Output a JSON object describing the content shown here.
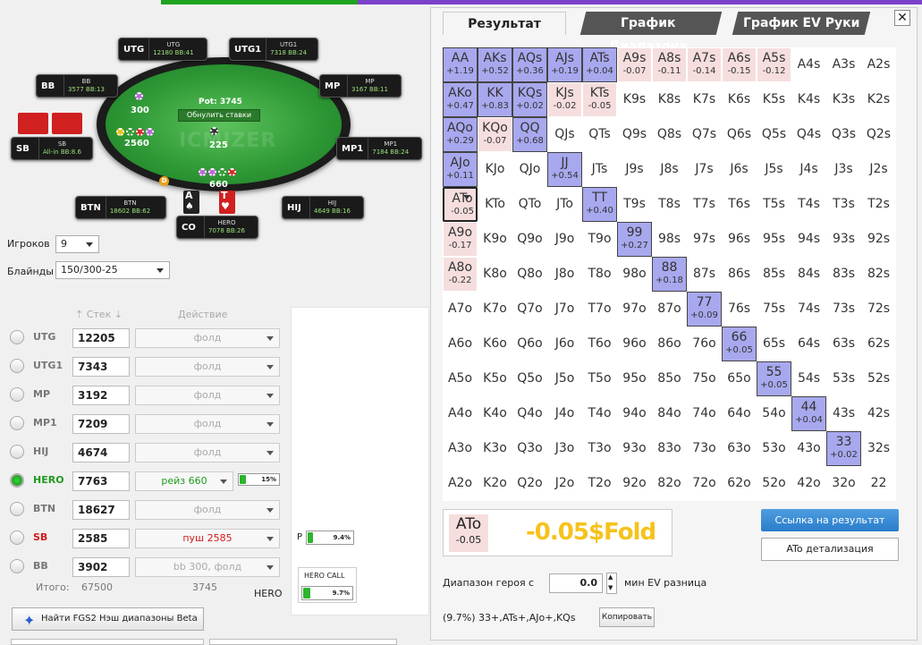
{
  "table": {
    "pot_label": "Pot: 3745",
    "reset_label": "Обнулить ставки",
    "watermark": "ICMIZER",
    "bets": [
      {
        "id": "utg",
        "value": "300"
      },
      {
        "id": "sb",
        "value": "2560"
      },
      {
        "id": "center",
        "value": "225"
      },
      {
        "id": "hero",
        "value": "660"
      }
    ],
    "dealer": "D",
    "hero_cards": [
      {
        "rank": "A",
        "suit": "♠"
      },
      {
        "rank": "T",
        "suit": "♥"
      }
    ],
    "seats": [
      {
        "id": "utg",
        "name": "UTG",
        "label": "UTG",
        "stack": "12180",
        "bb": "41"
      },
      {
        "id": "utg1",
        "name": "UTG1",
        "label": "UTG1",
        "stack": "7318",
        "bb": "24"
      },
      {
        "id": "bb",
        "name": "BB",
        "label": "BB",
        "stack": "3577",
        "bb": "13"
      },
      {
        "id": "mp",
        "name": "MP",
        "label": "MP",
        "stack": "3167",
        "bb": "11"
      },
      {
        "id": "sb",
        "name": "SB",
        "label": "SB",
        "stack": "All-in",
        "bb": "8.6"
      },
      {
        "id": "mp1",
        "name": "MP1",
        "label": "MP1",
        "stack": "7184",
        "bb": "24"
      },
      {
        "id": "btn",
        "name": "BTN",
        "label": "BTN",
        "stack": "18602",
        "bb": "62"
      },
      {
        "id": "hij",
        "name": "HIJ",
        "label": "HIJ",
        "stack": "4649",
        "bb": "16"
      },
      {
        "id": "co",
        "name": "CO",
        "label": "HERO",
        "stack": "7078",
        "bb": "26"
      }
    ]
  },
  "controls": {
    "players_label": "Игроков",
    "players_value": "9",
    "blinds_label": "Блайнды",
    "blinds_value": "150/300-25"
  },
  "players_table": {
    "stack_header": "Стек",
    "action_header": "Действие",
    "rows": [
      {
        "name": "UTG",
        "stack": "12205",
        "action": "фолд",
        "selected": false,
        "color": "#777"
      },
      {
        "name": "UTG1",
        "stack": "7343",
        "action": "фолд",
        "selected": false,
        "color": "#777"
      },
      {
        "name": "MP",
        "stack": "3192",
        "action": "фолд",
        "selected": false,
        "color": "#777"
      },
      {
        "name": "MP1",
        "stack": "7209",
        "action": "фолд",
        "selected": false,
        "color": "#777"
      },
      {
        "name": "HIJ",
        "stack": "4674",
        "action": "фолд",
        "selected": false,
        "color": "#777"
      },
      {
        "name": "HERO",
        "stack": "7763",
        "action": "рейз 660",
        "selected": true,
        "color": "#1e9a1e"
      },
      {
        "name": "BTN",
        "stack": "18627",
        "action": "фолд",
        "selected": false,
        "color": "#777"
      },
      {
        "name": "SB",
        "stack": "2585",
        "action": "пуш 2585",
        "selected": false,
        "color": "#d21a1a"
      },
      {
        "name": "BB",
        "stack": "3902",
        "action": "bb 300, фолд",
        "selected": false,
        "color": "#777"
      }
    ],
    "hero_equity": "15%",
    "hero_equity_value": 0.15,
    "total_label": "Итого:",
    "total_stack": "67500",
    "total_pot": "3745",
    "p_label": "P",
    "p_equity": "9.4%",
    "p_equity_value": 0.094,
    "hero_call_label": "HERO CALL",
    "hero_call_equity": "9.7%",
    "hero_call_value": 0.097,
    "hero_label": "HERO"
  },
  "find_button": "Найти FGS2 Нэш диапазоны Beta",
  "tabs": [
    "Результат",
    "График Диапазона",
    "График EV Руки"
  ],
  "close_label": "✕",
  "matrix": [
    [
      [
        "AA",
        "+1.19",
        "pos"
      ],
      [
        "AKs",
        "+0.52",
        "pos"
      ],
      [
        "AQs",
        "+0.36",
        "pos"
      ],
      [
        "AJs",
        "+0.19",
        "pos"
      ],
      [
        "ATs",
        "+0.04",
        "pos"
      ],
      [
        "A9s",
        "-0.07",
        "neg"
      ],
      [
        "A8s",
        "-0.11",
        "neg"
      ],
      [
        "A7s",
        "-0.14",
        "neg"
      ],
      [
        "A6s",
        "-0.15",
        "neg"
      ],
      [
        "A5s",
        "-0.12",
        "neg"
      ],
      [
        "A4s",
        "",
        ""
      ],
      [
        "A3s",
        "",
        ""
      ],
      [
        "A2s",
        "",
        ""
      ]
    ],
    [
      [
        "AKo",
        "+0.47",
        "pos"
      ],
      [
        "KK",
        "+0.83",
        "pos"
      ],
      [
        "KQs",
        "+0.02",
        "pos"
      ],
      [
        "KJs",
        "-0.02",
        "neg"
      ],
      [
        "KTs",
        "-0.05",
        "neg"
      ],
      [
        "K9s",
        "",
        ""
      ],
      [
        "K8s",
        "",
        ""
      ],
      [
        "K7s",
        "",
        ""
      ],
      [
        "K6s",
        "",
        ""
      ],
      [
        "K5s",
        "",
        ""
      ],
      [
        "K4s",
        "",
        ""
      ],
      [
        "K3s",
        "",
        ""
      ],
      [
        "K2s",
        "",
        ""
      ]
    ],
    [
      [
        "AQo",
        "+0.29",
        "pos"
      ],
      [
        "KQo",
        "-0.07",
        "neg"
      ],
      [
        "QQ",
        "+0.68",
        "pos"
      ],
      [
        "QJs",
        "",
        ""
      ],
      [
        "QTs",
        "",
        ""
      ],
      [
        "Q9s",
        "",
        ""
      ],
      [
        "Q8s",
        "",
        ""
      ],
      [
        "Q7s",
        "",
        ""
      ],
      [
        "Q6s",
        "",
        ""
      ],
      [
        "Q5s",
        "",
        ""
      ],
      [
        "Q4s",
        "",
        ""
      ],
      [
        "Q3s",
        "",
        ""
      ],
      [
        "Q2s",
        "",
        ""
      ]
    ],
    [
      [
        "AJo",
        "+0.11",
        "pos"
      ],
      [
        "KJo",
        "",
        ""
      ],
      [
        "QJo",
        "",
        ""
      ],
      [
        "JJ",
        "+0.54",
        "pos"
      ],
      [
        "JTs",
        "",
        ""
      ],
      [
        "J9s",
        "",
        ""
      ],
      [
        "J8s",
        "",
        ""
      ],
      [
        "J7s",
        "",
        ""
      ],
      [
        "J6s",
        "",
        ""
      ],
      [
        "J5s",
        "",
        ""
      ],
      [
        "J4s",
        "",
        ""
      ],
      [
        "J3s",
        "",
        ""
      ],
      [
        "J2s",
        "",
        ""
      ]
    ],
    [
      [
        "ATo",
        "-0.05",
        "sel"
      ],
      [
        "KTo",
        "",
        ""
      ],
      [
        "QTo",
        "",
        ""
      ],
      [
        "JTo",
        "",
        ""
      ],
      [
        "TT",
        "+0.40",
        "pos"
      ],
      [
        "T9s",
        "",
        ""
      ],
      [
        "T8s",
        "",
        ""
      ],
      [
        "T7s",
        "",
        ""
      ],
      [
        "T6s",
        "",
        ""
      ],
      [
        "T5s",
        "",
        ""
      ],
      [
        "T4s",
        "",
        ""
      ],
      [
        "T3s",
        "",
        ""
      ],
      [
        "T2s",
        "",
        ""
      ]
    ],
    [
      [
        "A9o",
        "-0.17",
        "neg"
      ],
      [
        "K9o",
        "",
        ""
      ],
      [
        "Q9o",
        "",
        ""
      ],
      [
        "J9o",
        "",
        ""
      ],
      [
        "T9o",
        "",
        ""
      ],
      [
        "99",
        "+0.27",
        "pos"
      ],
      [
        "98s",
        "",
        ""
      ],
      [
        "97s",
        "",
        ""
      ],
      [
        "96s",
        "",
        ""
      ],
      [
        "95s",
        "",
        ""
      ],
      [
        "94s",
        "",
        ""
      ],
      [
        "93s",
        "",
        ""
      ],
      [
        "92s",
        "",
        ""
      ]
    ],
    [
      [
        "A8o",
        "-0.22",
        "neg"
      ],
      [
        "K8o",
        "",
        ""
      ],
      [
        "Q8o",
        "",
        ""
      ],
      [
        "J8o",
        "",
        ""
      ],
      [
        "T8o",
        "",
        ""
      ],
      [
        "98o",
        "",
        ""
      ],
      [
        "88",
        "+0.18",
        "pos"
      ],
      [
        "87s",
        "",
        ""
      ],
      [
        "86s",
        "",
        ""
      ],
      [
        "85s",
        "",
        ""
      ],
      [
        "84s",
        "",
        ""
      ],
      [
        "83s",
        "",
        ""
      ],
      [
        "82s",
        "",
        ""
      ]
    ],
    [
      [
        "A7o",
        "",
        ""
      ],
      [
        "K7o",
        "",
        ""
      ],
      [
        "Q7o",
        "",
        ""
      ],
      [
        "J7o",
        "",
        ""
      ],
      [
        "T7o",
        "",
        ""
      ],
      [
        "97o",
        "",
        ""
      ],
      [
        "87o",
        "",
        ""
      ],
      [
        "77",
        "+0.09",
        "pos"
      ],
      [
        "76s",
        "",
        ""
      ],
      [
        "75s",
        "",
        ""
      ],
      [
        "74s",
        "",
        ""
      ],
      [
        "73s",
        "",
        ""
      ],
      [
        "72s",
        "",
        ""
      ]
    ],
    [
      [
        "A6o",
        "",
        ""
      ],
      [
        "K6o",
        "",
        ""
      ],
      [
        "Q6o",
        "",
        ""
      ],
      [
        "J6o",
        "",
        ""
      ],
      [
        "T6o",
        "",
        ""
      ],
      [
        "96o",
        "",
        ""
      ],
      [
        "86o",
        "",
        ""
      ],
      [
        "76o",
        "",
        ""
      ],
      [
        "66",
        "+0.05",
        "pos"
      ],
      [
        "65s",
        "",
        ""
      ],
      [
        "64s",
        "",
        ""
      ],
      [
        "63s",
        "",
        ""
      ],
      [
        "62s",
        "",
        ""
      ]
    ],
    [
      [
        "A5o",
        "",
        ""
      ],
      [
        "K5o",
        "",
        ""
      ],
      [
        "Q5o",
        "",
        ""
      ],
      [
        "J5o",
        "",
        ""
      ],
      [
        "T5o",
        "",
        ""
      ],
      [
        "95o",
        "",
        ""
      ],
      [
        "85o",
        "",
        ""
      ],
      [
        "75o",
        "",
        ""
      ],
      [
        "65o",
        "",
        ""
      ],
      [
        "55",
        "+0.05",
        "pos"
      ],
      [
        "54s",
        "",
        ""
      ],
      [
        "53s",
        "",
        ""
      ],
      [
        "52s",
        "",
        ""
      ]
    ],
    [
      [
        "A4o",
        "",
        ""
      ],
      [
        "K4o",
        "",
        ""
      ],
      [
        "Q4o",
        "",
        ""
      ],
      [
        "J4o",
        "",
        ""
      ],
      [
        "T4o",
        "",
        ""
      ],
      [
        "94o",
        "",
        ""
      ],
      [
        "84o",
        "",
        ""
      ],
      [
        "74o",
        "",
        ""
      ],
      [
        "64o",
        "",
        ""
      ],
      [
        "54o",
        "",
        ""
      ],
      [
        "44",
        "+0.04",
        "pos"
      ],
      [
        "43s",
        "",
        ""
      ],
      [
        "42s",
        "",
        ""
      ]
    ],
    [
      [
        "A3o",
        "",
        ""
      ],
      [
        "K3o",
        "",
        ""
      ],
      [
        "Q3o",
        "",
        ""
      ],
      [
        "J3o",
        "",
        ""
      ],
      [
        "T3o",
        "",
        ""
      ],
      [
        "93o",
        "",
        ""
      ],
      [
        "83o",
        "",
        ""
      ],
      [
        "73o",
        "",
        ""
      ],
      [
        "63o",
        "",
        ""
      ],
      [
        "53o",
        "",
        ""
      ],
      [
        "43o",
        "",
        ""
      ],
      [
        "33",
        "+0.02",
        "pos"
      ],
      [
        "32s",
        "",
        ""
      ]
    ],
    [
      [
        "A2o",
        "",
        ""
      ],
      [
        "K2o",
        "",
        ""
      ],
      [
        "Q2o",
        "",
        ""
      ],
      [
        "J2o",
        "",
        ""
      ],
      [
        "T2o",
        "",
        ""
      ],
      [
        "92o",
        "",
        ""
      ],
      [
        "82o",
        "",
        ""
      ],
      [
        "72o",
        "",
        ""
      ],
      [
        "62o",
        "",
        ""
      ],
      [
        "52o",
        "",
        ""
      ],
      [
        "42o",
        "",
        ""
      ],
      [
        "32o",
        "",
        ""
      ],
      [
        "22",
        "",
        ""
      ]
    ]
  ],
  "result": {
    "hand": "ATo",
    "ev": "-0.05",
    "text": "-0.05$Fold",
    "link_button": "Ссылка на результат",
    "detail_button": "ATo детализация",
    "range_label": "Диапазон героя с",
    "range_value": "0.0",
    "range_suffix": "мин EV разница",
    "range_text": "(9.7%) 33+,ATs+,AJo+,KQs",
    "copy_button": "Копировать"
  },
  "colors": {
    "accent_green": "#1fa31f",
    "accent_purple": "#7b42c9",
    "positive": "#a8a8ef",
    "negative": "#f6dede",
    "fold_text": "#f6c21c"
  }
}
